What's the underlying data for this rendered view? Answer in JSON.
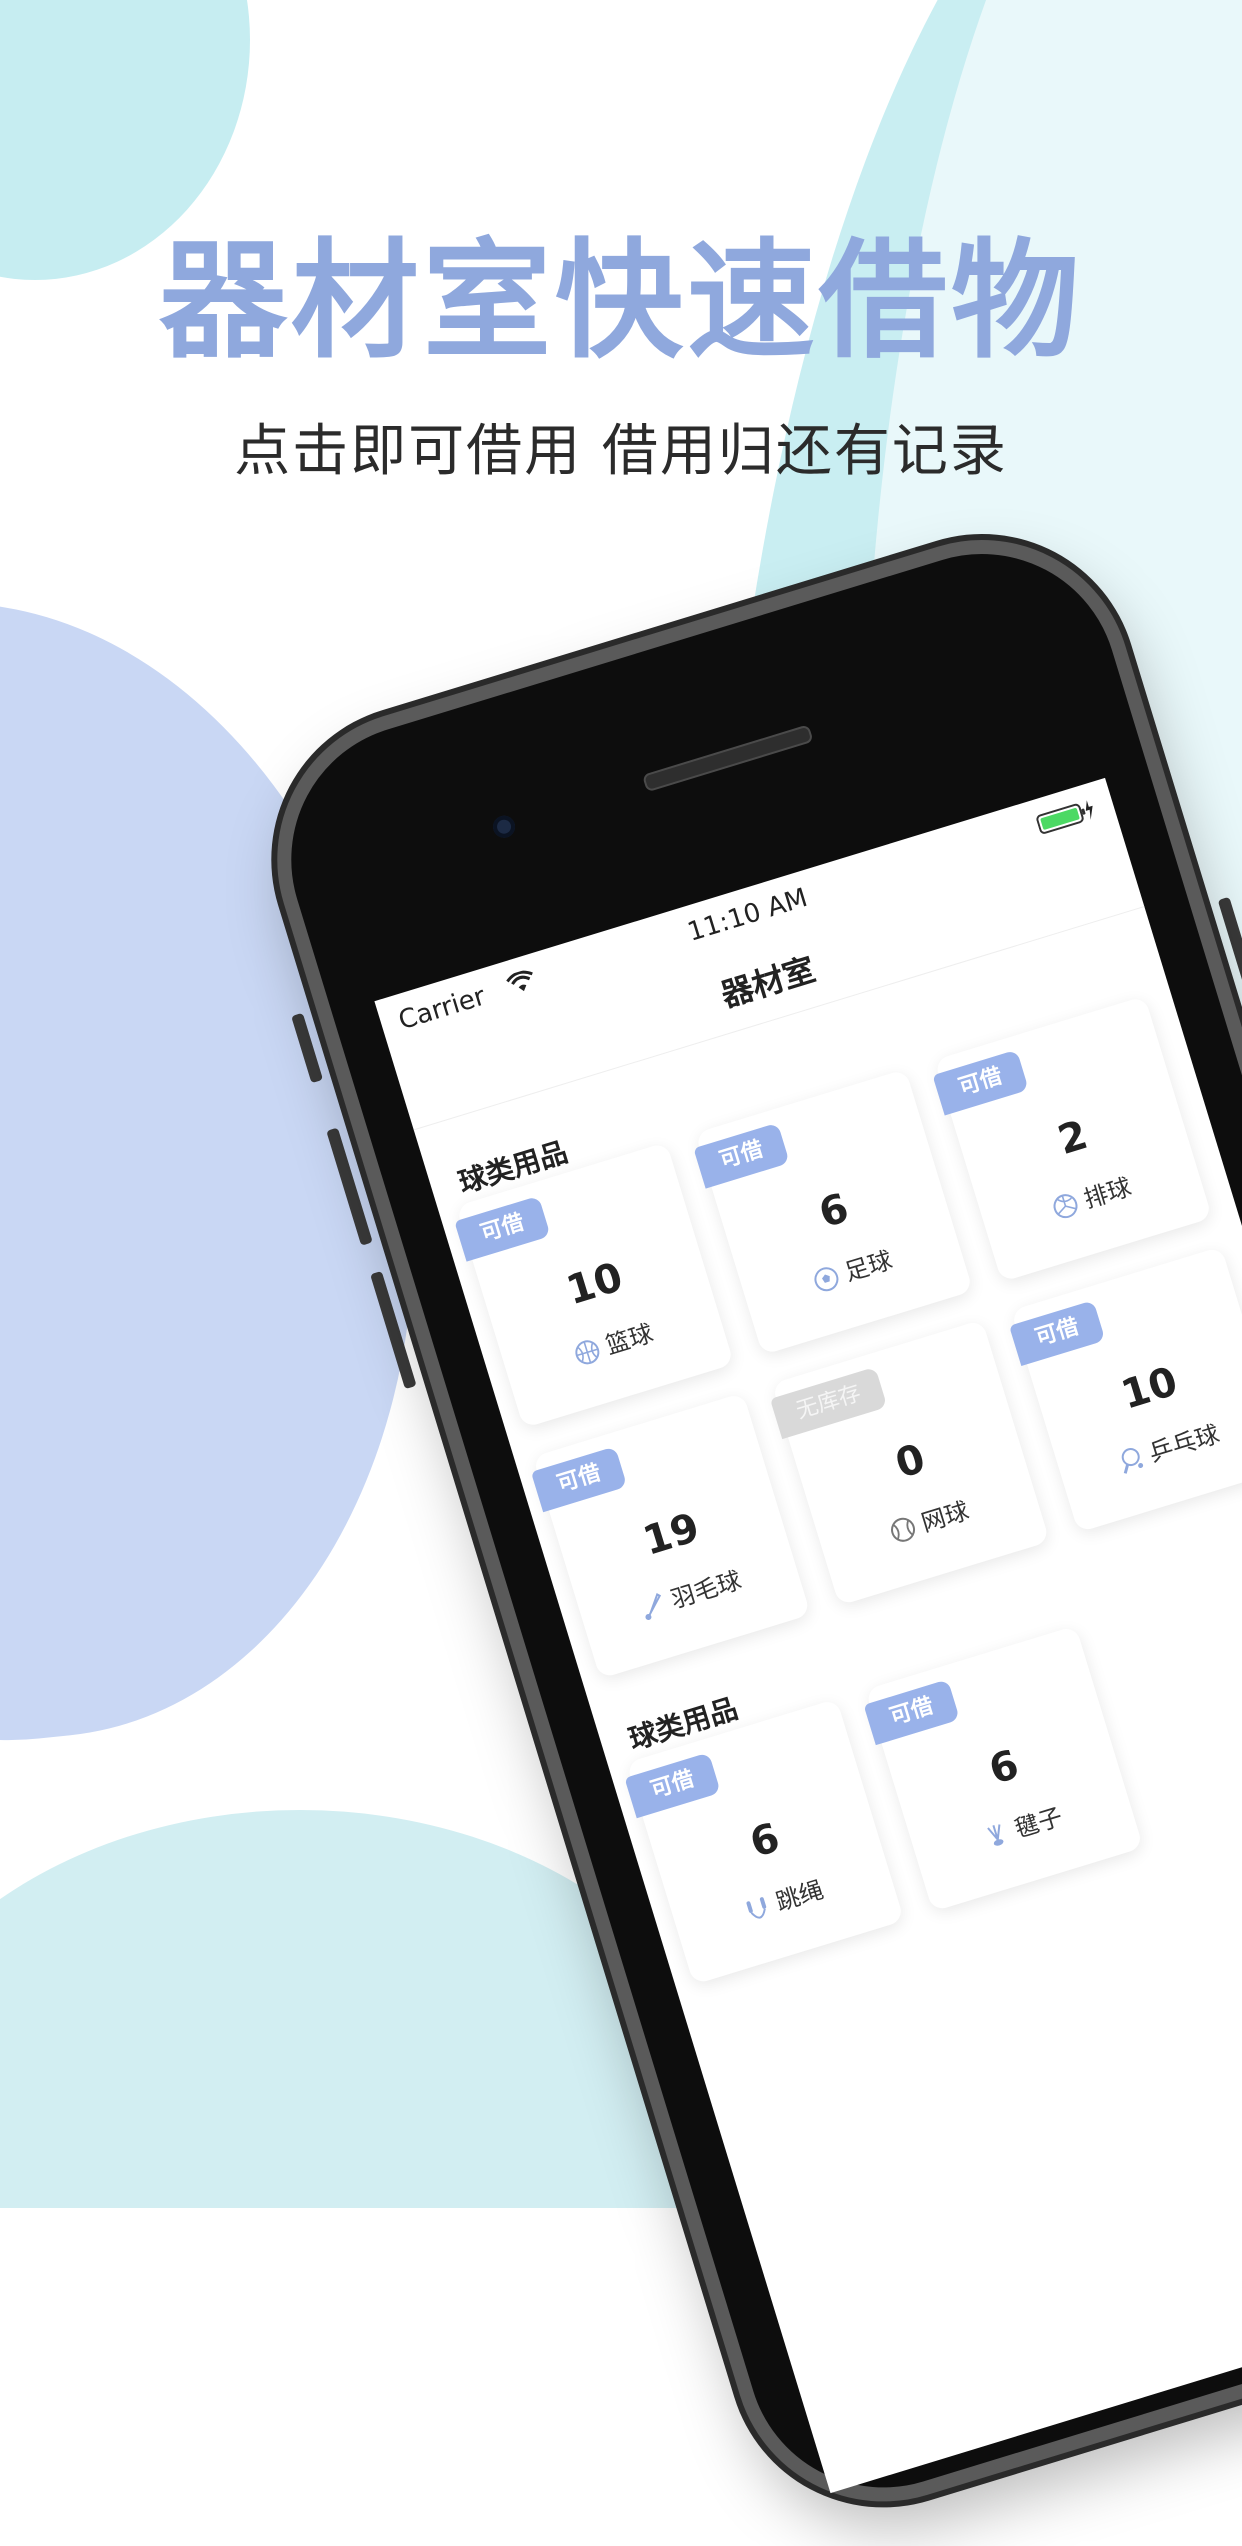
{
  "hero": {
    "title": "器材室快速借物",
    "subtitle": "点击即可借用  借用归还有记录"
  },
  "status_bar": {
    "carrier": "Carrier",
    "time": "11:10 AM"
  },
  "nav": {
    "title": "器材室"
  },
  "colors": {
    "accent": "#99b2ea",
    "title": "#8fa8dd",
    "out_of_stock": "#d9d9d9"
  },
  "sections": [
    {
      "title": "球类用品",
      "items": [
        {
          "badge": "可借",
          "count": "10",
          "name": "篮球",
          "icon": "basketball-icon"
        },
        {
          "badge": "可借",
          "count": "6",
          "name": "足球",
          "icon": "soccer-ball-icon"
        },
        {
          "badge": "可借",
          "count": "2",
          "name": "排球",
          "icon": "volleyball-icon"
        },
        {
          "badge": "可借",
          "count": "19",
          "name": "羽毛球",
          "icon": "shuttlecock-icon"
        },
        {
          "badge": "无库存",
          "count": "0",
          "name": "网球",
          "icon": "tennis-ball-icon"
        },
        {
          "badge": "可借",
          "count": "10",
          "name": "乒乓球",
          "icon": "ping-pong-icon"
        }
      ]
    },
    {
      "title": "球类用品",
      "items": [
        {
          "badge": "可借",
          "count": "6",
          "name": "跳绳",
          "icon": "jump-rope-icon"
        },
        {
          "badge": "可借",
          "count": "6",
          "name": "毽子",
          "icon": "shuttlecock-kick-icon"
        }
      ]
    }
  ]
}
